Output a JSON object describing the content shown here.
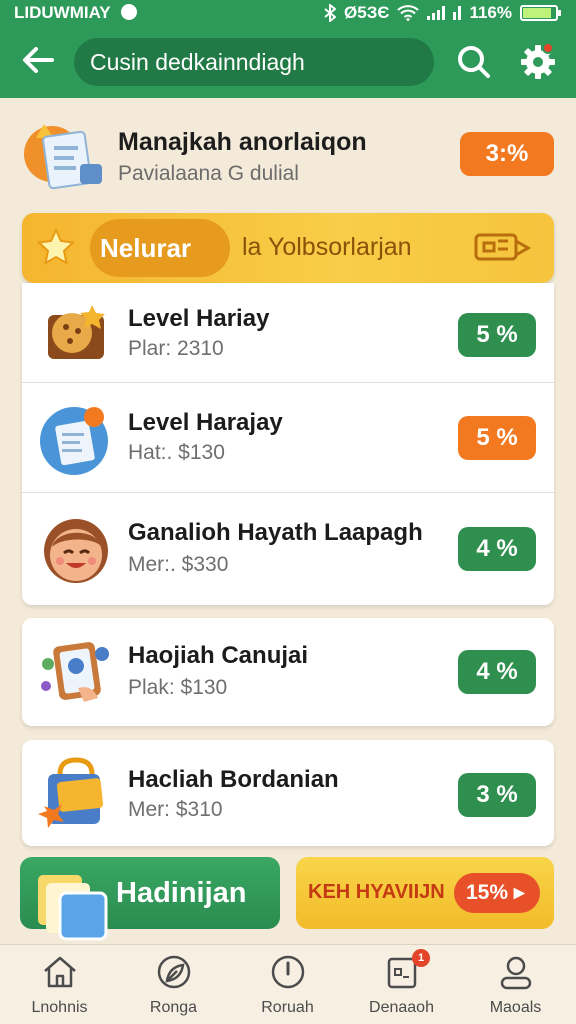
{
  "status_bar": {
    "carrier": "LIDUWMIAY",
    "network": "Ø5ЗЄ",
    "battery": "116%"
  },
  "header": {
    "search_text": "Cusin dedkainndiagh"
  },
  "summary": {
    "title": "Manajkah anorlaiqon",
    "subtitle": "Pavialaana G dulial",
    "percent": "3:%"
  },
  "banner": {
    "chip": "Nelurar",
    "text": "la Yolbsorlarjan"
  },
  "items": [
    {
      "title": "Level Hariay",
      "subtitle": "Plar: 2310",
      "percent": "5 %",
      "color": "#2f8f4f"
    },
    {
      "title": "Level Harajay",
      "subtitle": "Hat:. $130",
      "percent": "5 %",
      "color": "#f2791f"
    },
    {
      "title": "Ganalioh Hayath Laapagh",
      "subtitle": "Mer:. $330",
      "percent": "4 %",
      "color": "#2f8f4f"
    },
    {
      "title": "Haojiah Canujai",
      "subtitle": "Plak: $130",
      "percent": "4 %",
      "color": "#2f8f4f"
    },
    {
      "title": "Hacliah Bordanian",
      "subtitle": "Mer: $310",
      "percent": "3 %",
      "color": "#2f8f4f"
    }
  ],
  "actions": {
    "primary_label": "Hadinijan",
    "secondary_label": "KEH HYAVIIJN",
    "secondary_badge": "15% ▸"
  },
  "nav": [
    {
      "label": "Lnohnis",
      "icon": "home-icon"
    },
    {
      "label": "Ronga",
      "icon": "leaf-icon"
    },
    {
      "label": "Roruah",
      "icon": "clock-icon"
    },
    {
      "label": "Denaaoh",
      "icon": "document-icon",
      "badge": "1"
    },
    {
      "label": "Maoals",
      "icon": "profile-icon"
    }
  ],
  "colors": {
    "brand": "#2e9a5a",
    "accent": "#f2791f",
    "banner": "#f5b52f"
  }
}
